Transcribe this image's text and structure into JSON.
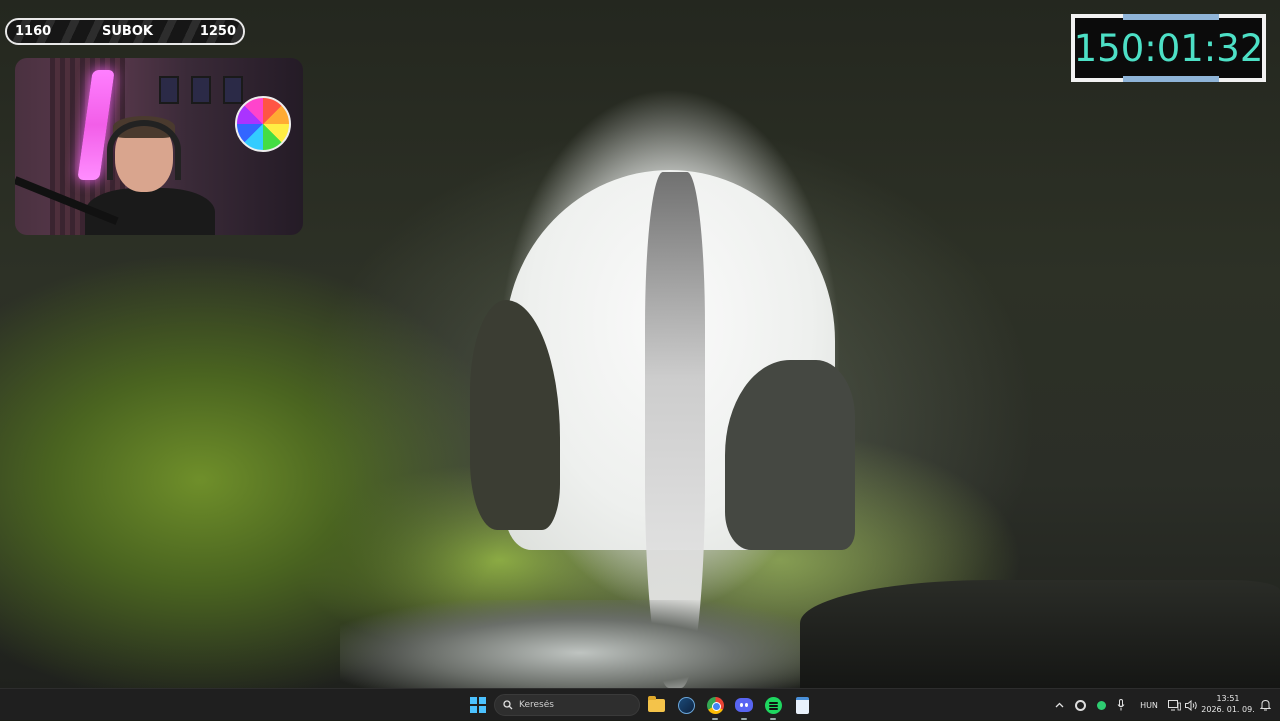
{
  "overlay": {
    "sub_counter": {
      "current": "1160",
      "label": "SUBOK",
      "goal": "1250"
    },
    "timer": {
      "value": "150:01:32"
    }
  },
  "taskbar": {
    "search": {
      "placeholder": "Keresés"
    },
    "pinned_apps": [
      {
        "name": "File Explorer",
        "icon": "folder-icon"
      },
      {
        "name": "Steam",
        "icon": "steam-icon"
      },
      {
        "name": "Google Chrome",
        "icon": "chrome-icon",
        "running": true
      },
      {
        "name": "Discord",
        "icon": "discord-icon",
        "running": true
      },
      {
        "name": "Spotify",
        "icon": "spotify-icon",
        "running": true
      },
      {
        "name": "Notepad",
        "icon": "notepad-icon"
      }
    ],
    "tray": {
      "language": "HUN",
      "time": "13:51",
      "date": "2026. 01. 09."
    }
  },
  "colors": {
    "timer_text": "#4de0c6",
    "timer_accent": "#8fb4d8",
    "taskbar_bg": "#1f1f1f",
    "windows_blue": "#4cc2ff"
  }
}
